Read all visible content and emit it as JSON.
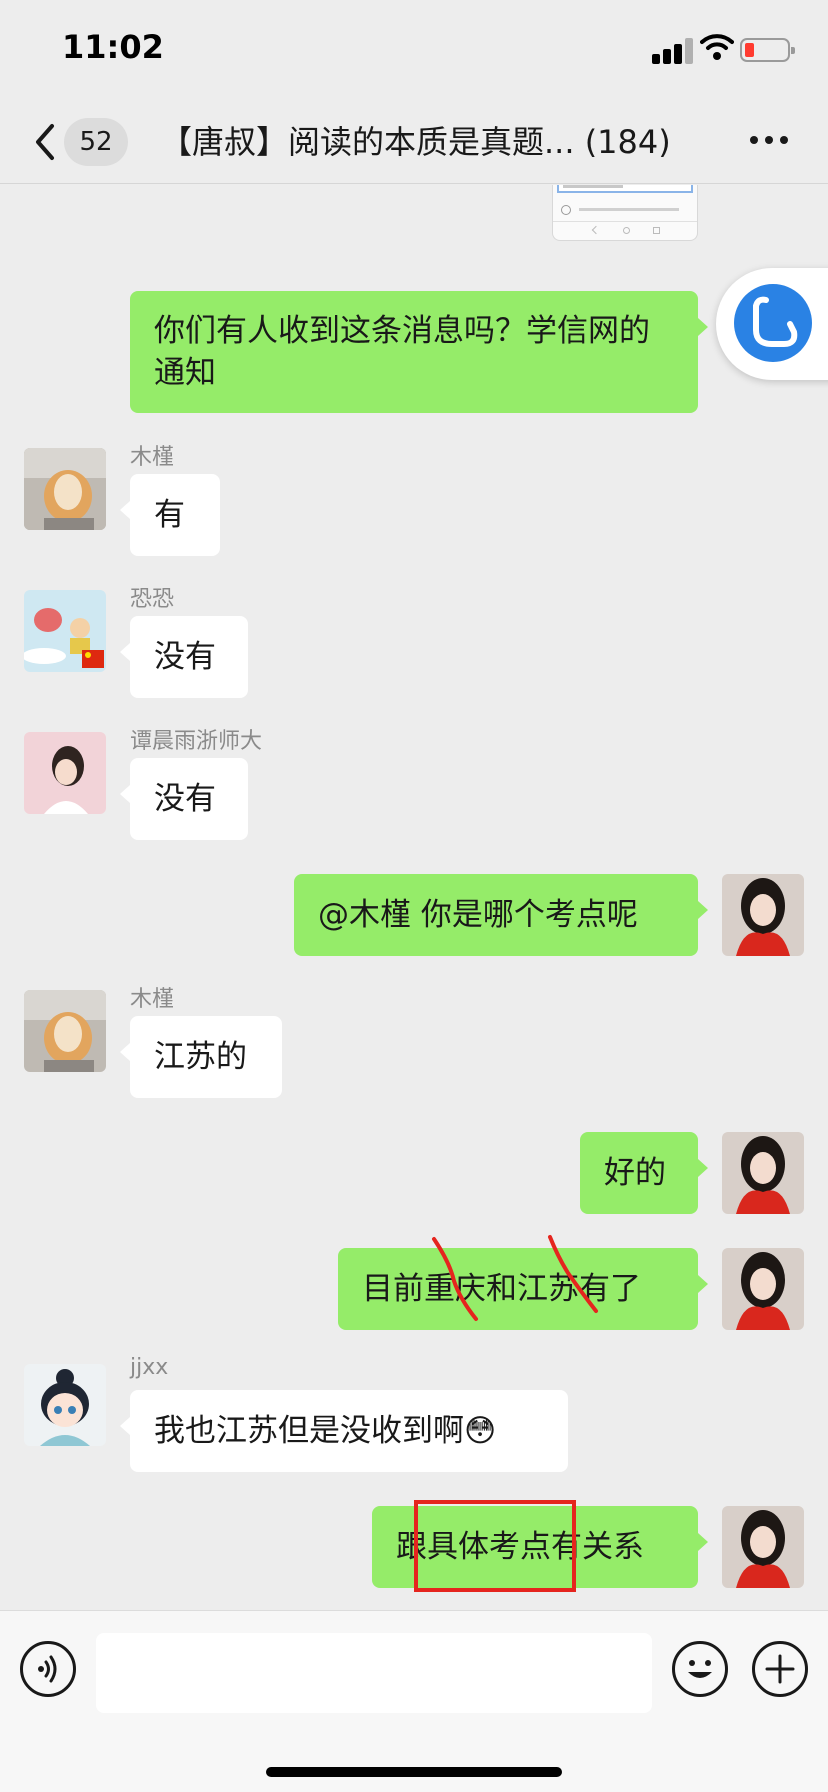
{
  "status_bar": {
    "time": "11:02"
  },
  "header": {
    "back_icon": "chevron-left-icon",
    "unread_count": "52",
    "title": "【唐叔】阅读的本质是真题... (184)",
    "more_icon": "ellipsis-icon"
  },
  "messages": [
    {
      "side": "out",
      "text": "你们有人收到这条消息吗？学信网的通知"
    },
    {
      "side": "in",
      "sender": "木槿",
      "text": "有"
    },
    {
      "side": "in",
      "sender": "恐恐",
      "text": "没有"
    },
    {
      "side": "in",
      "sender": "谭晨雨浙师大",
      "text": "没有"
    },
    {
      "side": "out",
      "text": "@木槿 你是哪个考点呢"
    },
    {
      "side": "in",
      "sender": "木槿",
      "text": "江苏的"
    },
    {
      "side": "out",
      "text": "好的"
    },
    {
      "side": "out",
      "text": "目前重庆和江苏有了"
    },
    {
      "side": "in",
      "sender": "jjxx",
      "text": "我也江苏但是没收到啊😳"
    },
    {
      "side": "out",
      "text": "跟具体考点有关系"
    }
  ],
  "input_bar": {
    "voice_icon": "voice-icon",
    "message_value": "",
    "emoji_icon": "smiley-icon",
    "plus_icon": "plus-icon"
  },
  "colors": {
    "outgoing_bubble": "#95ec69",
    "incoming_bubble": "#ffffff",
    "background": "#ededed",
    "annotation_red": "#e5251e",
    "floating_button": "#2a82e4"
  }
}
